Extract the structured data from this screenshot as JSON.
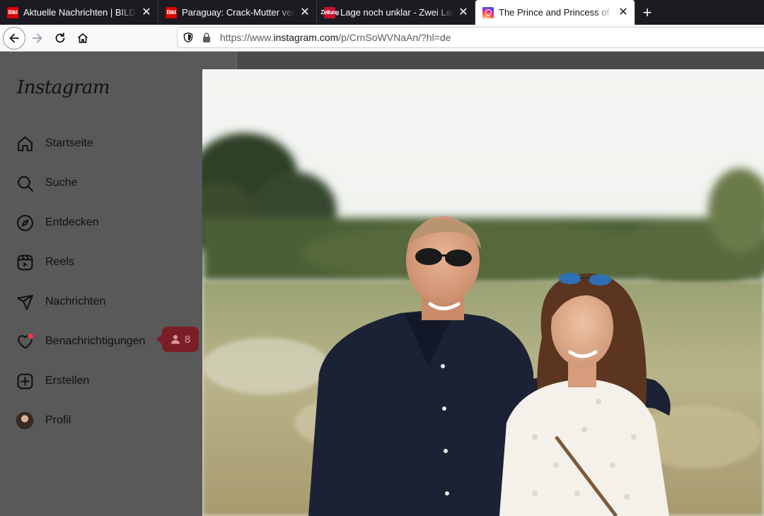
{
  "browser": {
    "tabs": [
      {
        "title": "Aktuelle Nachrichten | BILD.de",
        "favicon": "bild",
        "favicon_text": "Bild",
        "active": false
      },
      {
        "title": "Paraguay: Crack-Mutter verkauft",
        "favicon": "bild",
        "favicon_text": "Bild",
        "active": false
      },
      {
        "title": "Lage noch unklar - Zwei Lawinen",
        "favicon": "zeitung",
        "favicon_text": "Zeitung",
        "active": false
      },
      {
        "title": "The Prince and Princess of Wales",
        "favicon": "instagram",
        "favicon_text": "",
        "active": true
      }
    ],
    "close_glyph": "✕",
    "new_tab_glyph": "+",
    "url_prefix": "https://www.",
    "url_host": "instagram.com",
    "url_path": "/p/CrnSoWVNaAn/?hl=de"
  },
  "sidebar": {
    "logo": "Instagram",
    "items": [
      {
        "label": "Startseite",
        "icon": "home-icon"
      },
      {
        "label": "Suche",
        "icon": "search-icon"
      },
      {
        "label": "Entdecken",
        "icon": "compass-icon"
      },
      {
        "label": "Reels",
        "icon": "reels-icon"
      },
      {
        "label": "Nachrichten",
        "icon": "send-icon"
      },
      {
        "label": "Benachrichtigungen",
        "icon": "heart-icon"
      },
      {
        "label": "Erstellen",
        "icon": "plus-square-icon"
      },
      {
        "label": "Profil",
        "icon": "avatar"
      }
    ],
    "notification_tooltip": {
      "icon": "person-icon",
      "count": "8"
    }
  },
  "post": {
    "image": "photo"
  },
  "colors": {
    "sidebar_bg": "#595959",
    "tooltip_bg": "#7a1f28",
    "notification_dot": "#ff3040",
    "tab_strip_bg": "#1c1b22"
  }
}
